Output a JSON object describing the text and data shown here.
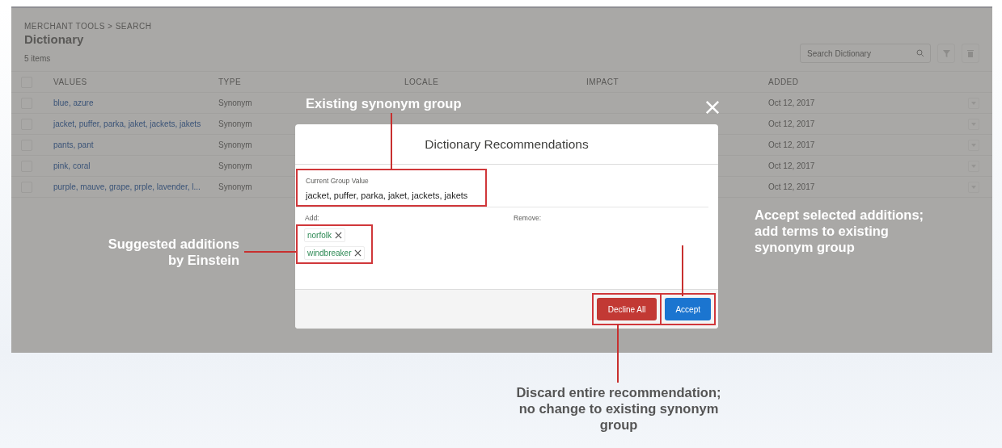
{
  "page": {
    "breadcrumb": "MERCHANT TOOLS > SEARCH",
    "title": "Dictionary",
    "item_count": "5 items",
    "search": {
      "placeholder": "Search Dictionary"
    }
  },
  "table": {
    "all_checked": false,
    "columns": [
      "VALUES",
      "TYPE",
      "LOCALE",
      "IMPACT",
      "ADDED"
    ],
    "rows": [
      {
        "values": "blue, azure",
        "type": "Synonym",
        "added": "Oct 12, 2017",
        "checked": false
      },
      {
        "values": "jacket, puffer, parka, jaket, jackets, jakets",
        "type": "Synonym",
        "added": "Oct 12, 2017",
        "checked": false
      },
      {
        "values": "pants, pant",
        "type": "Synonym",
        "added": "Oct 12, 2017",
        "checked": false
      },
      {
        "values": "pink, coral",
        "type": "Synonym",
        "added": "Oct 12, 2017",
        "checked": false
      },
      {
        "values": "purple, mauve, grape, prple, lavender, l...",
        "type": "Synonym",
        "added": "Oct 12, 2017",
        "checked": false
      }
    ]
  },
  "modal": {
    "title": "Dictionary Recommendations",
    "current_group_label": "Current Group Value",
    "current_group_value": "jacket, puffer, parka, jaket, jackets, jakets",
    "add_label": "Add:",
    "add_tags": [
      "norfolk",
      "windbreaker"
    ],
    "remove_label": "Remove:",
    "buttons": [
      {
        "label": "Decline All",
        "kind": "destructive"
      },
      {
        "label": "Accept",
        "kind": "brand"
      }
    ]
  },
  "annotations": [
    {
      "kind": "existing",
      "text": "Existing synonym group"
    },
    {
      "kind": "suggested",
      "text": "Suggested additions\nby Einstein"
    },
    {
      "kind": "accept",
      "text": "Accept selected additions;\nadd terms to existing\nsynonym group"
    },
    {
      "kind": "discard",
      "text": "Discard entire recommendation;\nno change to existing synonym\ngroup"
    }
  ]
}
